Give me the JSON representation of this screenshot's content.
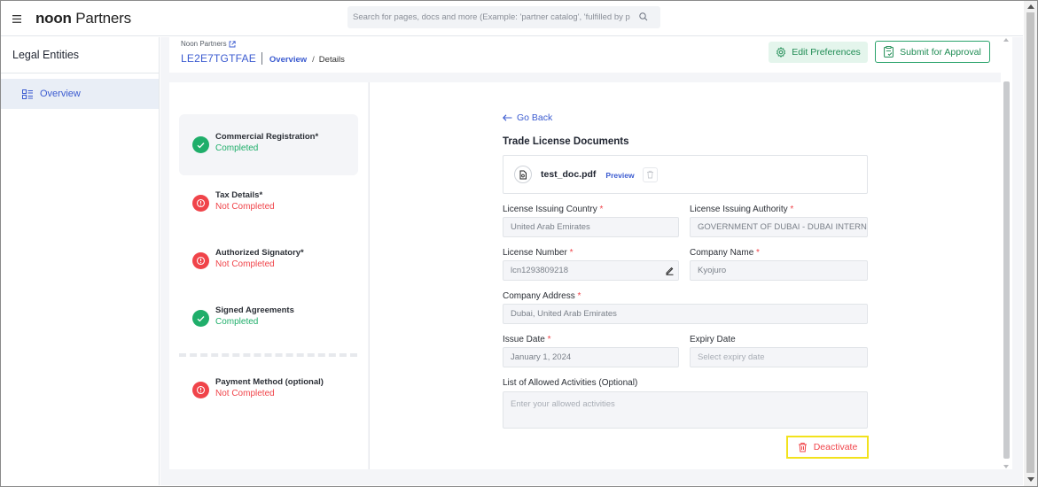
{
  "app": {
    "brand_bold": "noon",
    "brand_rest": " Partners"
  },
  "search": {
    "placeholder": "Search for pages, docs and more (Example: 'partner catalog', 'fulfilled by p"
  },
  "sidebar": {
    "title": "Legal Entities",
    "items": [
      {
        "label": "Overview",
        "icon": "list-icon"
      }
    ]
  },
  "breadcrumb": {
    "parent": "Noon Partners",
    "entity_id": "LE2E7TGTFAE",
    "link": "Overview",
    "separator": "/",
    "current": "Details"
  },
  "actions": {
    "edit_label": "Edit Preferences",
    "submit_label": "Submit for Approval"
  },
  "steps": [
    {
      "title": "Commercial Registration*",
      "status": "Completed",
      "state": "ok"
    },
    {
      "title": "Tax Details*",
      "status": "Not Completed",
      "state": "err"
    },
    {
      "title": "Authorized Signatory*",
      "status": "Not Completed",
      "state": "err"
    },
    {
      "title": "Signed Agreements",
      "status": "Completed",
      "state": "ok"
    },
    {
      "title": "Payment Method (optional)",
      "status": "Not Completed",
      "state": "err"
    }
  ],
  "form": {
    "go_back": "Go Back",
    "section_title": "Trade License Documents",
    "document": {
      "name": "test_doc.pdf",
      "preview_label": "Preview"
    },
    "fields": {
      "issuing_country": {
        "label": "License Issuing Country",
        "value": "United Arab Emirates"
      },
      "issuing_authority": {
        "label": "License Issuing Authority",
        "value": "GOVERNMENT OF DUBAI - DUBAI INTERNA"
      },
      "license_number": {
        "label": "License Number",
        "value": "lcn1293809218"
      },
      "company_name": {
        "label": "Company Name",
        "value": "Kyojuro"
      },
      "company_address": {
        "label": "Company Address",
        "value": "Dubai, United Arab Emirates"
      },
      "issue_date": {
        "label": "Issue Date",
        "value": "January 1, 2024"
      },
      "expiry_date": {
        "label": "Expiry Date",
        "placeholder": "Select expiry date"
      },
      "allowed_activities": {
        "label": "List of Allowed Activities (Optional)",
        "placeholder": "Enter your allowed activities"
      }
    },
    "required_mark": "*",
    "deactivate_label": "Deactivate"
  },
  "colors": {
    "primary_blue": "#3b5bd0",
    "success_green": "#1fae6a",
    "error_red": "#f0444a",
    "highlight_yellow": "#f2e21c"
  }
}
